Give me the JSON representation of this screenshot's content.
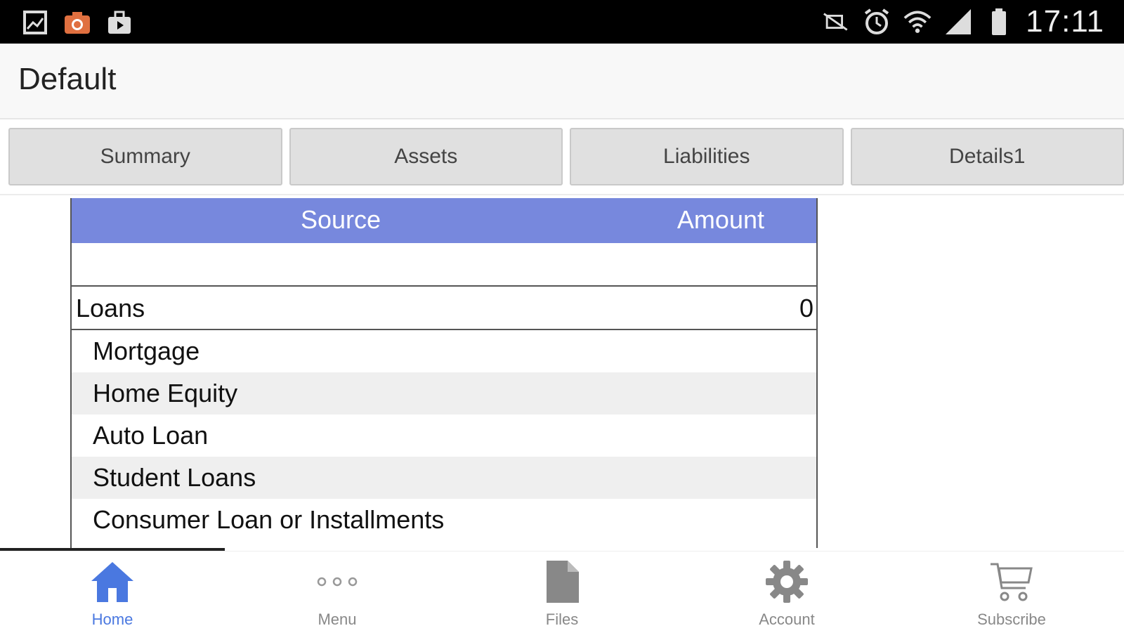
{
  "status_bar": {
    "left_icons": [
      "gallery-icon",
      "camera-icon",
      "briefcase-icon"
    ],
    "right_icons": [
      "mute-icon",
      "alarm-icon",
      "wifi-icon",
      "signal-icon",
      "battery-icon"
    ],
    "time": "17:11"
  },
  "app_bar": {
    "title": "Default"
  },
  "tabs": [
    {
      "label": "Summary"
    },
    {
      "label": "Assets"
    },
    {
      "label": "Liabilities"
    },
    {
      "label": "Details1"
    }
  ],
  "table": {
    "headers": {
      "source": "Source",
      "amount": "Amount"
    },
    "group": {
      "label": "Loans",
      "amount": "0"
    },
    "items": [
      {
        "label": "Mortgage"
      },
      {
        "label": "Home Equity"
      },
      {
        "label": "Auto Loan"
      },
      {
        "label": "Student Loans"
      },
      {
        "label": "Consumer Loan or Installments"
      }
    ]
  },
  "bottom_nav": {
    "items": [
      {
        "label": "Home",
        "icon": "home-icon",
        "active": true
      },
      {
        "label": "Menu",
        "icon": "dots-icon"
      },
      {
        "label": "Files",
        "icon": "file-icon"
      },
      {
        "label": "Account",
        "icon": "gear-icon"
      },
      {
        "label": "Subscribe",
        "icon": "cart-icon"
      }
    ]
  },
  "colors": {
    "header_bg": "#7788dd",
    "active_nav": "#4a78e0",
    "tab_bg": "#e0e0e0"
  }
}
